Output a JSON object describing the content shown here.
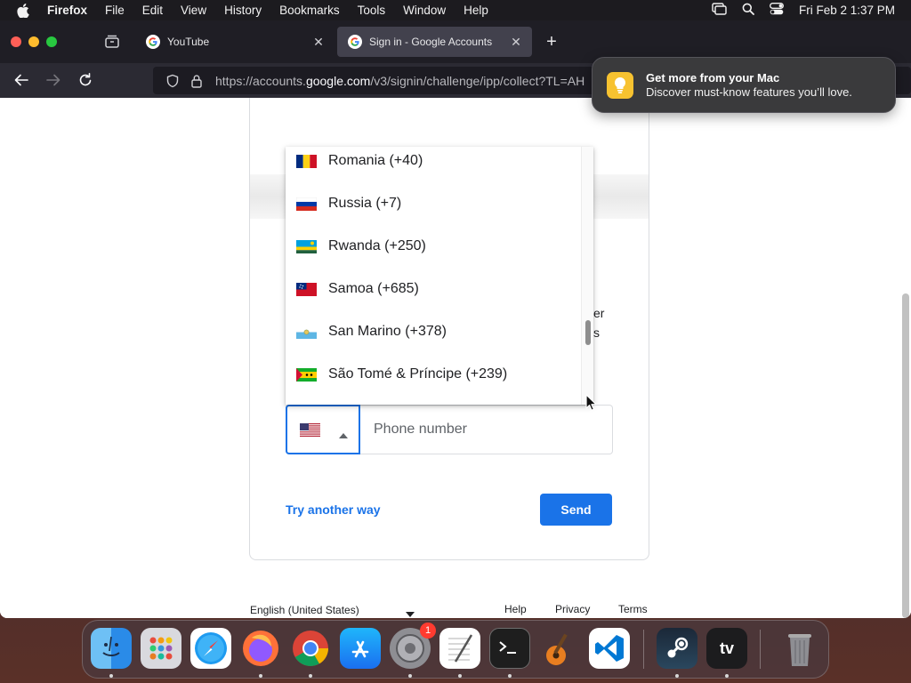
{
  "menubar": {
    "app_name": "Firefox",
    "items": [
      "File",
      "Edit",
      "View",
      "History",
      "Bookmarks",
      "Tools",
      "Window",
      "Help"
    ],
    "clock": "Fri Feb 2  1:37 PM"
  },
  "tabs": [
    {
      "title": "YouTube",
      "icon": "google-icon",
      "active": false
    },
    {
      "title": "Sign in - Google Accounts",
      "icon": "google-icon",
      "active": true
    }
  ],
  "urlbar": {
    "url_prefix": "https://accounts.",
    "url_domain": "google.com",
    "url_suffix": "/v3/signin/challenge/ipp/collect?TL=AH"
  },
  "notification": {
    "title": "Get more from your Mac",
    "body": "Discover must-know features you’ll love."
  },
  "signin": {
    "phone_placeholder": "Phone number",
    "selected_country_flag": "us-flag",
    "try_another_way": "Try another way",
    "send_label": "Send",
    "hidden_text_fragment_1": "er",
    "hidden_text_fragment_2": "s"
  },
  "country_dropdown": {
    "items": [
      {
        "label": "Romania (+40)",
        "flag": "romania-flag"
      },
      {
        "label": "Russia (+7)",
        "flag": "russia-flag"
      },
      {
        "label": "Rwanda (+250)",
        "flag": "rwanda-flag"
      },
      {
        "label": "Samoa (+685)",
        "flag": "samoa-flag"
      },
      {
        "label": "San Marino (+378)",
        "flag": "san-marino-flag"
      },
      {
        "label": "São Tomé & Príncipe (+239)",
        "flag": "sao-tome-flag"
      }
    ]
  },
  "footer": {
    "language": "English (United States)",
    "help": "Help",
    "privacy": "Privacy",
    "terms": "Terms"
  },
  "dock": {
    "apps": [
      "Finder",
      "Launchpad",
      "Safari",
      "Firefox",
      "Chrome",
      "App Store",
      "System Settings",
      "TextEdit",
      "Terminal",
      "GarageBand",
      "Visual Studio Code",
      "Steam",
      "Apple TV",
      "Trash"
    ],
    "settings_badge": "1",
    "tv_label": "tv"
  },
  "colors": {
    "google_blue": "#1a73e8",
    "menubar_bg": "#1c1b1f",
    "tab_active_bg": "#42414d"
  }
}
